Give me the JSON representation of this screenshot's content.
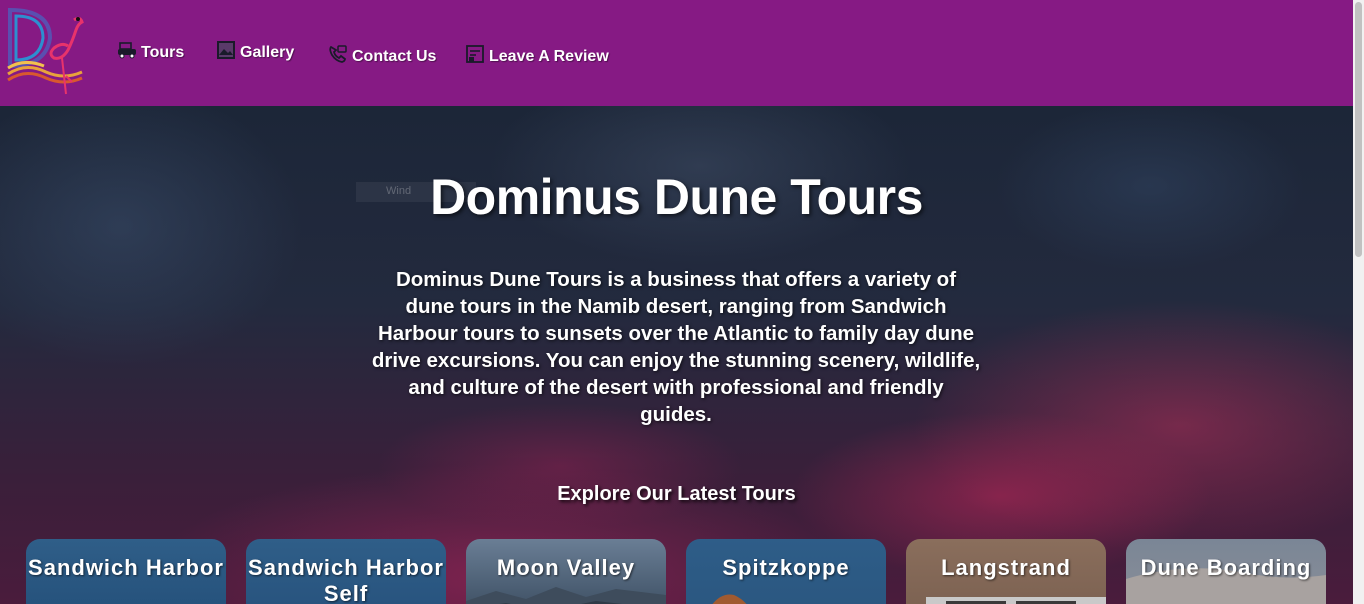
{
  "nav": {
    "items": [
      {
        "label": "Tours",
        "icon": "car-icon"
      },
      {
        "label": "Gallery",
        "icon": "image-icon"
      },
      {
        "label": "Contact Us",
        "icon": "phone-chat-icon"
      },
      {
        "label": "Leave A Review",
        "icon": "review-icon"
      }
    ]
  },
  "hero": {
    "title": "Dominus Dune Tours",
    "description": "Dominus Dune Tours is a business that offers a variety of dune tours in the Namib desert, ranging from Sandwich Harbour tours to sunsets over the Atlantic to family day dune drive excursions. You can enjoy the stunning scenery, wildlife, and culture of the desert with professional and friendly guides.",
    "faint_label": "Wind"
  },
  "tours": {
    "heading": "Explore Our Latest Tours",
    "cards": [
      {
        "title": "Sandwich Harbor"
      },
      {
        "title": "Sandwich Harbor Self"
      },
      {
        "title": "Moon Valley"
      },
      {
        "title": "Spitzkoppe"
      },
      {
        "title": "Langstrand"
      },
      {
        "title": "Dune Boarding"
      }
    ]
  },
  "colors": {
    "navbar": "#861a84",
    "text": "#ffffff"
  }
}
